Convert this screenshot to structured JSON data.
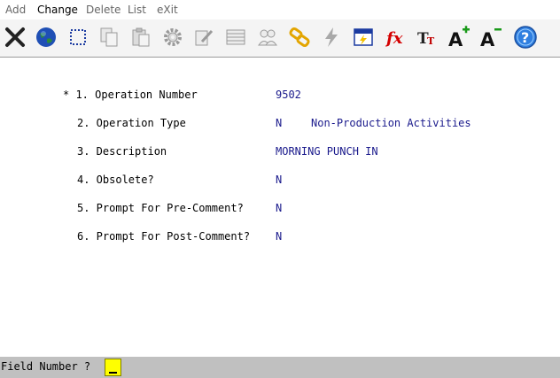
{
  "menu": {
    "items": [
      {
        "label": "Add",
        "active": false
      },
      {
        "label": "Change",
        "active": true
      },
      {
        "label": "Delete",
        "active": false
      },
      {
        "label": "List",
        "active": false
      },
      {
        "label": "eXit",
        "active": false
      }
    ]
  },
  "toolbar": {
    "buttons": [
      {
        "icon": "close-icon",
        "enabled": true
      },
      {
        "icon": "globe-icon",
        "enabled": true
      },
      {
        "icon": "select-box-icon",
        "enabled": true
      },
      {
        "icon": "copy-icon",
        "enabled": false
      },
      {
        "icon": "paste-icon",
        "enabled": false
      },
      {
        "icon": "gear-icon",
        "enabled": false
      },
      {
        "icon": "edit-icon",
        "enabled": false
      },
      {
        "icon": "list-icon",
        "enabled": false
      },
      {
        "icon": "users-icon",
        "enabled": false
      },
      {
        "icon": "link-icon",
        "enabled": true
      },
      {
        "icon": "lightning-icon",
        "enabled": false
      },
      {
        "icon": "calendar-icon",
        "enabled": true
      },
      {
        "icon": "fx-icon",
        "enabled": true
      },
      {
        "icon": "font-size-icon",
        "enabled": true
      },
      {
        "icon": "font-increase-icon",
        "enabled": true
      },
      {
        "icon": "font-decrease-icon",
        "enabled": true
      },
      {
        "icon": "help-icon",
        "enabled": true
      }
    ]
  },
  "form": {
    "fields": [
      {
        "label": "* 1. Operation Number",
        "value": "9502",
        "extra": ""
      },
      {
        "label": "2. Operation Type",
        "value": "N",
        "extra": "Non-Production Activities"
      },
      {
        "label": "3. Description",
        "value": "MORNING PUNCH IN",
        "extra": ""
      },
      {
        "label": "4. Obsolete?",
        "value": "N",
        "extra": ""
      },
      {
        "label": "5. Prompt For Pre-Comment?",
        "value": "N",
        "extra": ""
      },
      {
        "label": "6. Prompt For Post-Comment?",
        "value": "N",
        "extra": ""
      }
    ]
  },
  "status": {
    "prompt": "Field Number ?",
    "input_value": ""
  },
  "colors": {
    "value_text": "#1a1a8c",
    "status_bar": "#c0c0c0",
    "cursor_box": "#ffff00"
  }
}
